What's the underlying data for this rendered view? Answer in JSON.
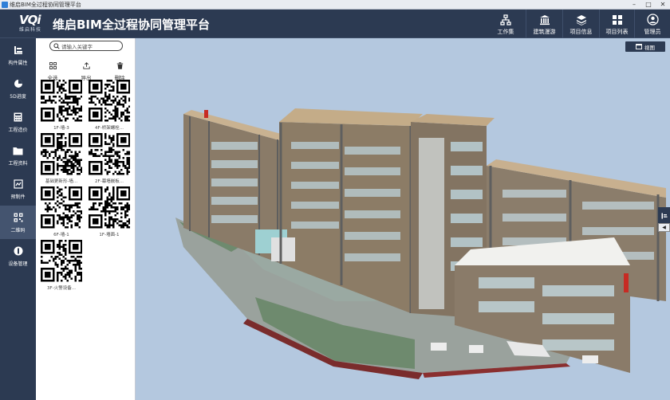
{
  "window": {
    "title": "维启BIM全过程协同管理平台"
  },
  "header": {
    "logo_mark": "VQi",
    "logo_sub": "维启科技",
    "app_title": "维启BIM全过程协同管理平台",
    "nav": [
      {
        "label": "工作集",
        "icon": "workset-icon"
      },
      {
        "label": "建筑漫游",
        "icon": "building-icon"
      },
      {
        "label": "项目信息",
        "icon": "layers-icon"
      },
      {
        "label": "项目列表",
        "icon": "grid-icon"
      },
      {
        "label": "管理员",
        "icon": "user-icon"
      }
    ]
  },
  "sidebar": {
    "items": [
      {
        "label": "构件属性",
        "icon": "component-icon"
      },
      {
        "label": "5D进度",
        "icon": "progress-icon"
      },
      {
        "label": "工程造价",
        "icon": "calculator-icon"
      },
      {
        "label": "工程资料",
        "icon": "folder-icon"
      },
      {
        "label": "预制件",
        "icon": "prefab-icon"
      },
      {
        "label": "二维码",
        "icon": "qrcode-icon"
      },
      {
        "label": "设备管理",
        "icon": "device-icon"
      }
    ]
  },
  "panel": {
    "search_placeholder": "请输入关键字",
    "tools": [
      {
        "label": "全选",
        "icon": "select-all-icon"
      },
      {
        "label": "导出",
        "icon": "export-icon"
      },
      {
        "label": "删除",
        "icon": "trash-icon"
      }
    ],
    "qr_items": [
      {
        "caption": "1F-墙-3"
      },
      {
        "caption": "4F-桥架螺栓..."
      },
      {
        "caption": "基础更新形-墙..."
      },
      {
        "caption": "2F-幕墙嵌板..."
      },
      {
        "caption": "6F-墙-1"
      },
      {
        "caption": "1F-墙面-1"
      },
      {
        "caption": "3F-火警设备..."
      }
    ]
  },
  "viewport": {
    "view_button": "视图",
    "right_tab": "构件"
  },
  "colors": {
    "header_bg": "#2c3a52",
    "viewport_bg": "#b4c8df",
    "accent_active": "#44546f"
  }
}
